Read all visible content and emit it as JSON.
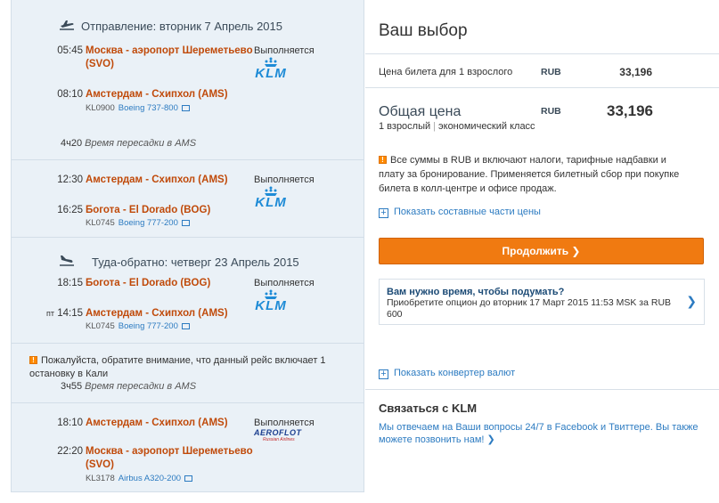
{
  "outbound": {
    "header": "Отправление: вторник 7 Апрель 2015",
    "seg1": {
      "dep_time": "05:45",
      "dep_city": "Москва - аэропорт Шереметьево (SVO)",
      "status": "Выполняется",
      "airline_logo": "KLM",
      "arr_time": "08:10",
      "arr_city": "Амстердам - Схипхол (AMS)",
      "flight": "KL0900",
      "aircraft": "Boeing 737-800"
    },
    "transfer": {
      "duration": "4ч20",
      "label": "Время пересадки в AMS"
    },
    "seg2": {
      "dep_time": "12:30",
      "dep_city": "Амстердам - Схипхол (AMS)",
      "status": "Выполняется",
      "airline_logo": "KLM",
      "arr_time": "16:25",
      "arr_city": "Богота - El Dorado (BOG)",
      "flight": "KL0745",
      "aircraft": "Boeing 777-200"
    }
  },
  "return": {
    "header": "Туда-обратно: четверг 23 Апрель 2015",
    "seg1": {
      "dep_time": "18:15",
      "dep_city": "Богота - El Dorado (BOG)",
      "status": "Выполняется",
      "airline_logo": "KLM",
      "arr_day": "пт",
      "arr_time": "14:15",
      "arr_city": "Амстердам - Схипхол (AMS)",
      "flight": "KL0745",
      "aircraft": "Boeing 777-200"
    },
    "notice": "Пожалуйста, обратите внимание, что данный рейс включает 1 остановку в Кали",
    "transfer": {
      "duration": "3ч55",
      "label": "Время пересадки в AMS"
    },
    "seg2": {
      "dep_time": "18:10",
      "dep_city": "Амстердам - Схипхол (AMS)",
      "status": "Выполняется",
      "airline_logo": "AEROFLOT",
      "airline_sub": "Russian Airlines",
      "arr_time": "22:20",
      "arr_city": "Москва - аэропорт Шереметьево (SVO)",
      "flight": "KL3178",
      "aircraft": "Airbus A320-200"
    }
  },
  "summary": {
    "title": "Ваш выбор",
    "ticket_label": "Цена билета для 1 взрослого",
    "currency": "RUB",
    "ticket_price": "33,196",
    "total_label": "Общая цена",
    "total_price": "33,196",
    "passengers": "1 взрослый",
    "cabin": "экономический класс",
    "notice": "Все суммы в RUB и включают налоги, тарифные надбавки и плату за бронирование. Применяется билетный сбор при покупке билета в колл-центре и офисе продаж.",
    "show_breakdown": "Показать составные части цены",
    "continue_label": "Продолжить ❯",
    "think_title": "Вам нужно время, чтобы подумать?",
    "think_text": "Приобретите опцион до вторник 17 Март 2015 11:53 MSK за RUB 600",
    "show_converter": "Показать конвертер валют",
    "contact_title": "Связаться с KLM",
    "contact_text": "Мы отвечаем на Ваши вопросы 24/7 в Facebook и Твиттере. Вы также можете позвонить нам! ❯"
  },
  "colors": {
    "accent_orange": "#f07a11",
    "link_blue": "#2c7bc1",
    "city_orange": "#c04a0a",
    "klm_blue": "#1e8bd6",
    "panel_bg": "#eaf1f7"
  },
  "icons": {
    "departure": "plane-departure-icon",
    "return": "plane-landing-icon",
    "info": "info-icon",
    "expand": "plus-icon",
    "chevron": "chevron-right-icon",
    "window": "new-window-icon"
  }
}
